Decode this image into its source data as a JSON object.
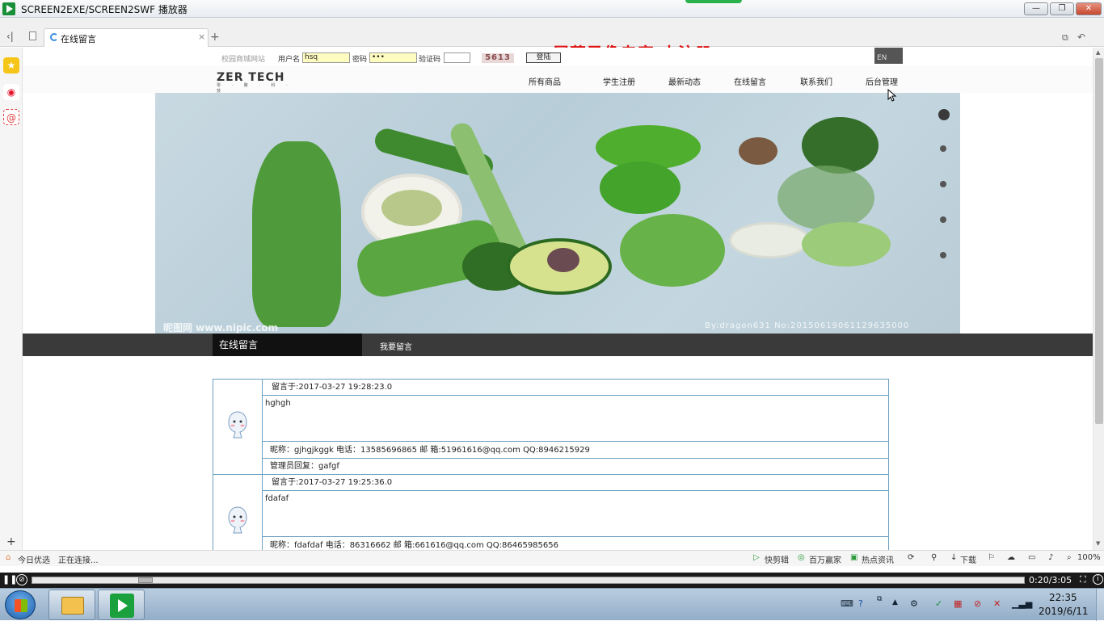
{
  "window": {
    "title": "SCREEN2EXE/SCREEN2SWF 播放器",
    "minimize": "—",
    "restore": "❐",
    "close": "✕"
  },
  "browser": {
    "back": "‹|",
    "tab_title": "在线留言",
    "tab_close": "×",
    "new_tab": "+",
    "watermark": "屏幕录像专家 未注册"
  },
  "login": {
    "site_label": "校园商城网站",
    "username_label": "用户名",
    "username_value": "hsq",
    "password_label": "密码",
    "password_value": "•••",
    "captcha_label": "验证码",
    "captcha_value": "",
    "captcha_image": "5613",
    "login_button": "登陆",
    "lang_button": "EN"
  },
  "nav": {
    "logo_text": "ZER TECH",
    "logo_sub": "零 · 聚 · 科 · 技",
    "items": [
      "所有商品",
      "学生注册",
      "最新动态",
      "在线留言",
      "联系我们",
      "后台管理"
    ]
  },
  "banner": {
    "watermark_left": "昵图网 www.nipic.com",
    "watermark_right": "By:dragon631 No:20150619061129635000"
  },
  "category": {
    "active": "在线留言",
    "link": "我要留言"
  },
  "messages": [
    {
      "time": "留言于:2017-03-27 19:28:23.0",
      "body": "hghgh",
      "info": "昵称：gjhgjkggk    电话：13585696865  邮 箱:51961616@qq.com    QQ:8946215929",
      "reply": "管理员回复：gafgf"
    },
    {
      "time": "留言于:2017-03-27 19:25:36.0",
      "body": "fdafaf",
      "info": "昵称：fdafdaf    电话：86316662  邮 箱:661616@qq.com    QQ:86465985656",
      "reply": ""
    }
  ],
  "statusbar": {
    "left_label": "今日优选",
    "status": "正在连接...",
    "items": [
      "快剪辑",
      "百万赢家",
      "热点资讯"
    ],
    "download": "下载",
    "zoom": "100%"
  },
  "player": {
    "time": "0:20/3:05",
    "progress": 0.108
  },
  "taskbar": {
    "clock_time": "22:35",
    "clock_date": "2019/6/11"
  }
}
